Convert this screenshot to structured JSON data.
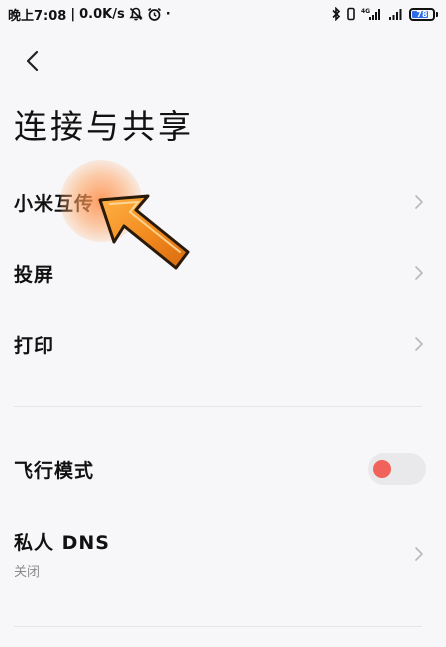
{
  "status_bar": {
    "time": "晚上7:08",
    "speed": "0.0K/s",
    "battery_level": "78",
    "network_badge": "4G",
    "icons": [
      "mute-bell-icon",
      "alarm-icon",
      "bluetooth-icon",
      "vibrate-icon",
      "signal-icon",
      "signal-icon",
      "battery-icon"
    ]
  },
  "header": {
    "back_icon": "chevron-left-icon",
    "title": "连接与共享"
  },
  "items": [
    {
      "label": "小米互传",
      "icon": "chevron-right-icon"
    },
    {
      "label": "投屏",
      "icon": "chevron-right-icon"
    },
    {
      "label": "打印",
      "icon": "chevron-right-icon"
    }
  ],
  "airplane_mode": {
    "label": "飞行模式",
    "enabled": false,
    "toggle_knob_color": "#f0625a"
  },
  "private_dns": {
    "label": "私人 DNS",
    "status": "关闭",
    "icon": "chevron-right-icon"
  },
  "overlay": {
    "pointer_icon": "tutorial-arrow-icon",
    "highlight_color": "#ff8c46"
  }
}
